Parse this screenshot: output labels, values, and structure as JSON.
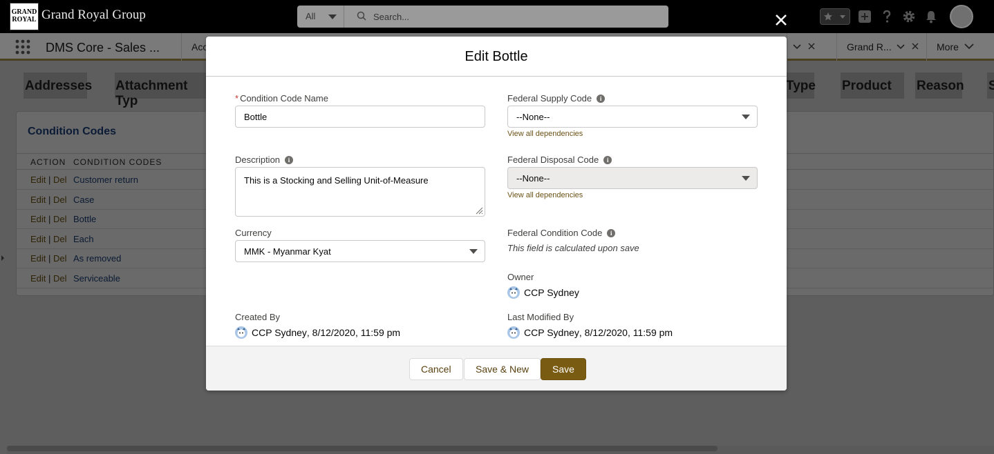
{
  "header": {
    "logo_line1": "GRAND",
    "logo_line2": "ROYAL",
    "brand": "Grand Royal Group",
    "search_scope": "All",
    "search_placeholder": "Search..."
  },
  "app_nav": {
    "app_name": "DMS Core - Sales ...",
    "tabs": [
      {
        "label": "Acc"
      },
      {
        "label": "Grand R..."
      },
      {
        "label": "More"
      }
    ]
  },
  "related_tabs": [
    "Addresses",
    "Attachment Typ",
    "Type",
    "Product",
    "Reason",
    "S"
  ],
  "card": {
    "title": "Condition Codes",
    "col_action": "ACTION",
    "col_codes": "CONDITION CODES",
    "edit_label": "Edit",
    "sep": "|",
    "del_label": "Del",
    "rows": [
      "Customer return",
      "Case",
      "Bottle",
      "Each",
      "As removed",
      "Serviceable"
    ]
  },
  "modal": {
    "title": "Edit Bottle",
    "fields": {
      "condition_code_name": {
        "required_mark": "*",
        "label": "Condition Code Name",
        "value": "Bottle"
      },
      "description": {
        "label": "Description",
        "value": "This is a Stocking and Selling Unit-of-Measure"
      },
      "currency": {
        "label": "Currency",
        "value": "MMK - Myanmar Kyat"
      },
      "federal_supply_code": {
        "label": "Federal Supply Code",
        "value": "--None--",
        "link": "View all dependencies"
      },
      "federal_disposal_code": {
        "label": "Federal Disposal Code",
        "value": "--None--",
        "link": "View all dependencies"
      },
      "federal_condition_code": {
        "label": "Federal Condition Code",
        "value": "This field is calculated upon save"
      },
      "owner": {
        "label": "Owner",
        "value": "CCP Sydney"
      },
      "created_by": {
        "label": "Created By",
        "user": "CCP Sydney",
        "date": ", 8/12/2020, 11:59 pm"
      },
      "last_modified_by": {
        "label": "Last Modified By",
        "user": "CCP Sydney",
        "date": ", 8/12/2020, 11:59 pm"
      }
    },
    "buttons": {
      "cancel": "Cancel",
      "save_new": "Save & New",
      "save": "Save"
    }
  },
  "colors": {
    "brand_button": "#7a5b12",
    "link": "#6b5216",
    "required": "#c23934"
  }
}
